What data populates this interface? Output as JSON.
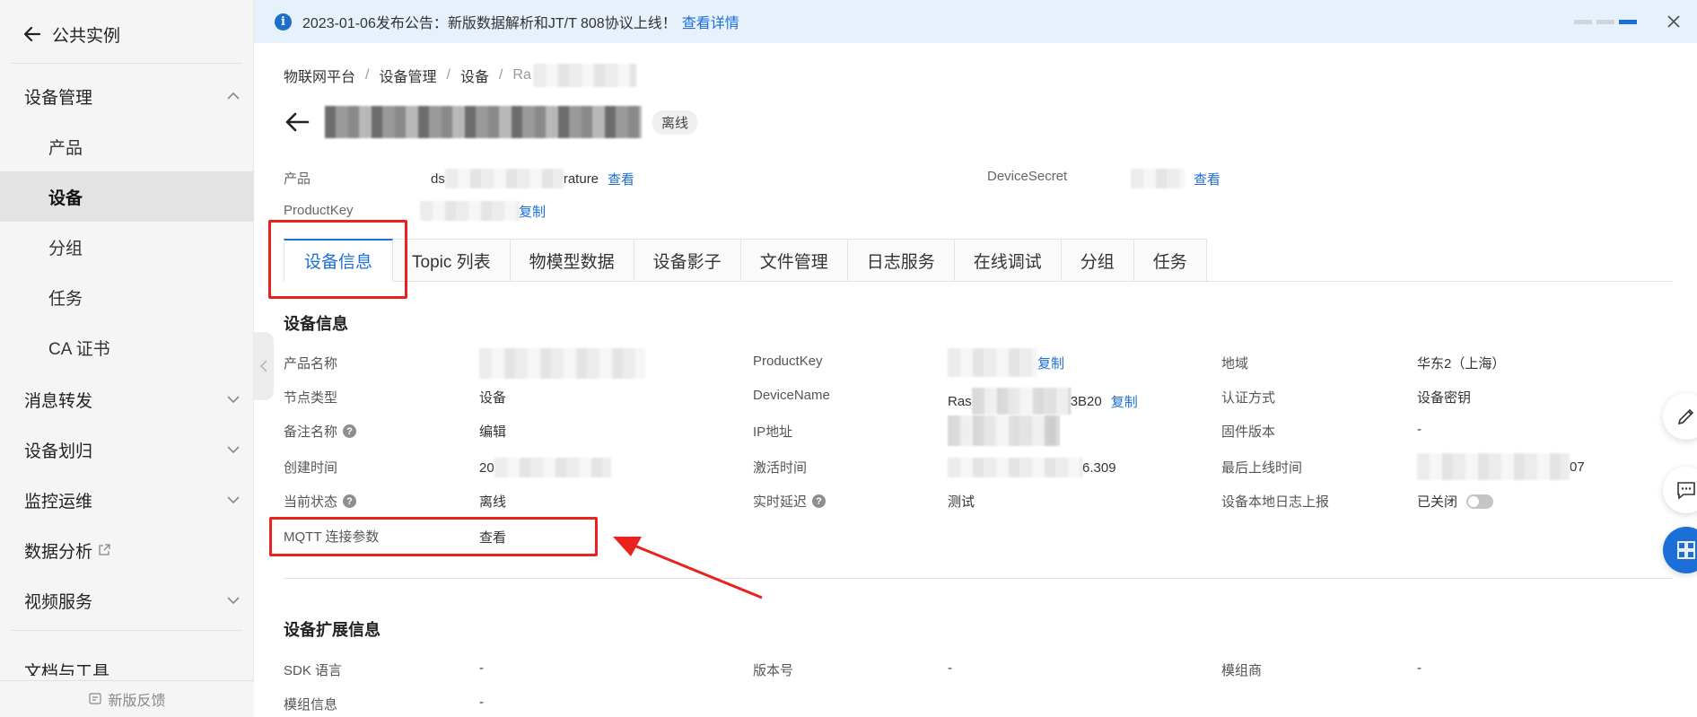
{
  "sidebar": {
    "back_label": "公共实例",
    "groups": [
      {
        "label": "设备管理",
        "expanded": true,
        "items": [
          {
            "label": "产品",
            "active": false
          },
          {
            "label": "设备",
            "active": true
          },
          {
            "label": "分组",
            "active": false
          },
          {
            "label": "任务",
            "active": false
          },
          {
            "label": "CA 证书",
            "active": false
          }
        ]
      },
      {
        "label": "消息转发"
      },
      {
        "label": "设备划归"
      },
      {
        "label": "监控运维"
      },
      {
        "label": "数据分析"
      },
      {
        "label": "视频服务"
      }
    ],
    "partial_item": "文档与工具",
    "footer_label": "新版反馈"
  },
  "announcement": {
    "text": "2023-01-06发布公告：新版数据解析和JT/T 808协议上线！",
    "link": "查看详情"
  },
  "breadcrumb": [
    "物联网平台",
    "设备管理",
    "设备",
    "Ra"
  ],
  "device": {
    "status": "离线",
    "meta": {
      "product_label": "产品",
      "product_value_prefix": "ds",
      "product_value_suffix": "rature",
      "product_link": "查看",
      "secret_label": "DeviceSecret",
      "secret_link": "查看",
      "productkey_label": "ProductKey",
      "productkey_link": "复制"
    }
  },
  "tabs": [
    {
      "label": "设备信息",
      "active": true
    },
    {
      "label": "Topic 列表",
      "active": false
    },
    {
      "label": "物模型数据",
      "active": false
    },
    {
      "label": "设备影子",
      "active": false
    },
    {
      "label": "文件管理",
      "active": false
    },
    {
      "label": "日志服务",
      "active": false
    },
    {
      "label": "在线调试",
      "active": false
    },
    {
      "label": "分组",
      "active": false
    },
    {
      "label": "任务",
      "active": false
    }
  ],
  "device_info": {
    "title": "设备信息",
    "product_name_label": "产品名称",
    "node_type_label": "节点类型",
    "node_type_value": "设备",
    "remark_label": "备注名称",
    "remark_link": "编辑",
    "created_label": "创建时间",
    "created_prefix": "20",
    "status_label": "当前状态",
    "status_value": "离线",
    "mqtt_label": "MQTT 连接参数",
    "mqtt_link": "查看",
    "productkey_label": "ProductKey",
    "productkey_link": "复制",
    "devicename_label": "DeviceName",
    "devicename_prefix": "Ras",
    "devicename_suffix": "3B20",
    "devicename_link": "复制",
    "ip_label": "IP地址",
    "activated_label": "激活时间",
    "activated_suffix": "6.309",
    "latency_label": "实时延迟",
    "latency_link": "测试",
    "region_label": "地域",
    "region_value": "华东2（上海）",
    "auth_label": "认证方式",
    "auth_value": "设备密钥",
    "firmware_label": "固件版本",
    "firmware_value": "-",
    "last_online_label": "最后上线时间",
    "last_online_suffix": "07",
    "local_log_label": "设备本地日志上报",
    "local_log_value": "已关闭"
  },
  "ext_info": {
    "title": "设备扩展信息",
    "sdk_label": "SDK 语言",
    "sdk_value": "-",
    "version_label": "版本号",
    "version_value": "-",
    "vendor_label": "模组商",
    "vendor_value": "-",
    "module_label": "模组信息",
    "module_value": "-"
  },
  "help_glyph": "?",
  "info_glyph": "i",
  "colors": {
    "accent": "#1b6fd6",
    "annotation": "#e8221f",
    "announce_bg": "#e6f1fc",
    "sidebar_bg": "#f5f5f5"
  },
  "icons": [
    "arrow-left-icon",
    "chevron-up-icon",
    "chevron-down-icon",
    "external-link-icon",
    "info-icon",
    "close-icon",
    "help-icon",
    "edit-icon",
    "chat-icon",
    "apps-icon",
    "feedback-icon"
  ]
}
